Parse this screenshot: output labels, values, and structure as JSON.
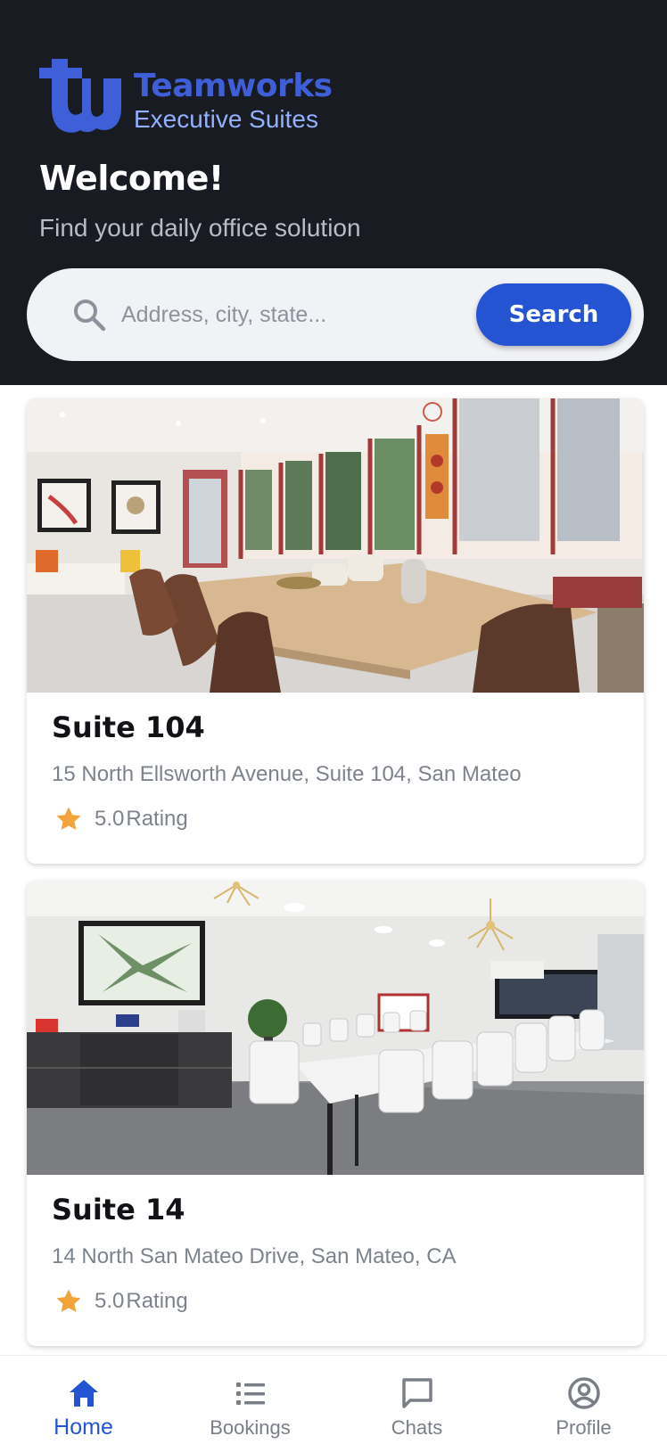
{
  "header": {
    "logo_name": "Teamworks",
    "logo_subtitle": "Executive Suites",
    "welcome": "Welcome!",
    "tagline": "Find your daily office solution"
  },
  "search": {
    "placeholder": "Address, city, state...",
    "button_label": "Search"
  },
  "listings": [
    {
      "title": "Suite 104",
      "address": "15 North Ellsworth Avenue, Suite 104,  San Mateo",
      "rating": "5.0",
      "rating_label": "Rating"
    },
    {
      "title": "Suite 14",
      "address": "14 North San Mateo Drive, San Mateo, CA",
      "rating": "5.0",
      "rating_label": "Rating"
    }
  ],
  "tabs": [
    {
      "label": "Home",
      "icon": "home-icon",
      "active": true
    },
    {
      "label": "Bookings",
      "icon": "list-icon",
      "active": false
    },
    {
      "label": "Chats",
      "icon": "chat-icon",
      "active": false
    },
    {
      "label": "Profile",
      "icon": "profile-icon",
      "active": false
    }
  ],
  "colors": {
    "header_bg": "#181b21",
    "accent": "#2554d3",
    "logo_primary": "#3f5fd8",
    "logo_secondary": "#93b0ff",
    "star": "#f2a33a",
    "muted_text": "#7d838c"
  }
}
